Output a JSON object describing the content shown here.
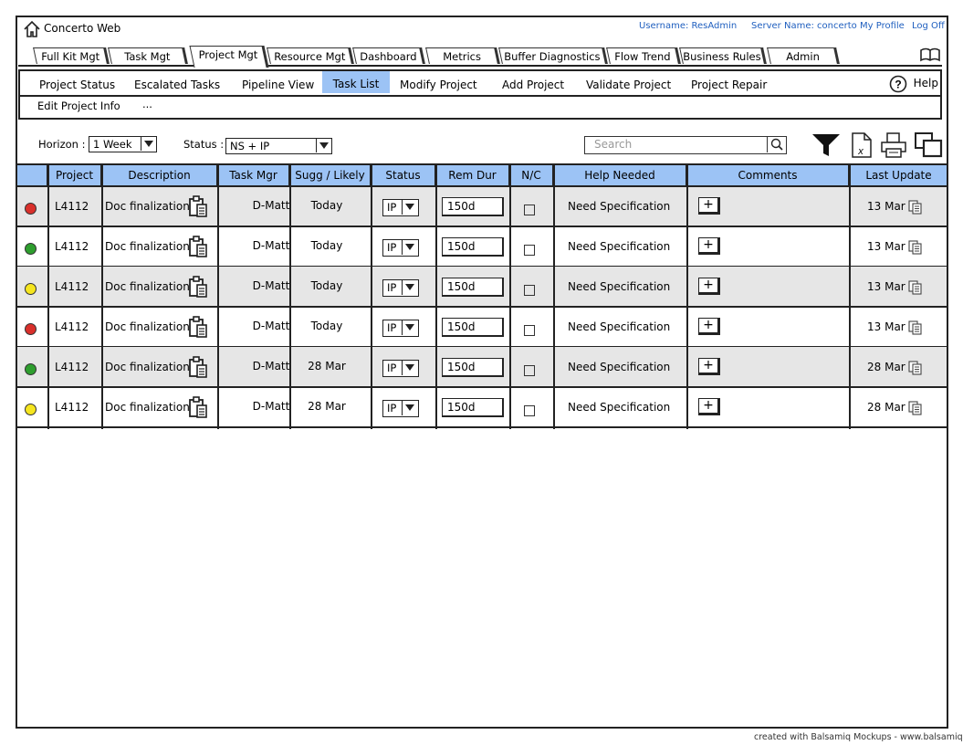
{
  "app": {
    "title": "Concerto Web"
  },
  "top_links": {
    "username": "Username: ResAdmin",
    "server": "Server Name: concerto",
    "my_profile": "My Profile",
    "log_off": "Log Off"
  },
  "tabs": [
    {
      "label": "Full Kit Mgt"
    },
    {
      "label": "Task Mgt"
    },
    {
      "label": "Project Mgt",
      "active": true
    },
    {
      "label": "Resource Mgt"
    },
    {
      "label": "Dashboard"
    },
    {
      "label": "Metrics"
    },
    {
      "label": "Buffer Diagnostics"
    },
    {
      "label": "Flow Trend"
    },
    {
      "label": "Business Rules"
    },
    {
      "label": "Admin"
    }
  ],
  "submenu": {
    "items": [
      {
        "label": "Project Status"
      },
      {
        "label": "Escalated Tasks"
      },
      {
        "label": "Pipeline View"
      },
      {
        "label": "Task List",
        "active": true
      },
      {
        "label": "Modify Project"
      },
      {
        "label": "Add Project"
      },
      {
        "label": "Validate Project"
      },
      {
        "label": "Project Repair"
      }
    ],
    "row2": [
      "Edit Project Info",
      "..."
    ],
    "help_label": "Help"
  },
  "filters": {
    "horizon_label": "Horizon :",
    "horizon_value": "1 Week",
    "status_label": "Status :",
    "status_value": "NS + IP",
    "search_placeholder": "Search"
  },
  "table": {
    "headers": [
      "Project",
      "Description",
      "Task Mgr",
      "Sugg / Likely",
      "Status",
      "Rem Dur",
      "N/C",
      "Help Needed",
      "Comments",
      "Last Update"
    ],
    "rows": [
      {
        "indicator": "red",
        "project": "L4112",
        "description": "Doc finalization",
        "task_mgr": "D-Matt",
        "sugg": "Today",
        "status": "IP",
        "rem_dur": "150d",
        "help": "Need Specification",
        "comment_btn": "+",
        "last_update": "13 Mar"
      },
      {
        "indicator": "green",
        "project": "L4112",
        "description": "Doc finalization",
        "task_mgr": "D-Matt",
        "sugg": "Today",
        "status": "IP",
        "rem_dur": "150d",
        "help": "Need Specification",
        "comment_btn": "+",
        "last_update": "13 Mar"
      },
      {
        "indicator": "yellow",
        "project": "L4112",
        "description": "Doc finalization",
        "task_mgr": "D-Matt",
        "sugg": "Today",
        "status": "IP",
        "rem_dur": "150d",
        "help": "Need Specification",
        "comment_btn": "+",
        "last_update": "13 Mar"
      },
      {
        "indicator": "red",
        "project": "L4112",
        "description": "Doc finalization",
        "task_mgr": "D-Matt",
        "sugg": "Today",
        "status": "IP",
        "rem_dur": "150d",
        "help": "Need Specification",
        "comment_btn": "+",
        "last_update": "13 Mar"
      },
      {
        "indicator": "green",
        "project": "L4112",
        "description": "Doc finalization",
        "task_mgr": "D-Matt",
        "sugg": "28 Mar",
        "status": "IP",
        "rem_dur": "150d",
        "help": "Need Specification",
        "comment_btn": "+",
        "last_update": "28 Mar"
      },
      {
        "indicator": "yellow",
        "project": "L4112",
        "description": "Doc finalization",
        "task_mgr": "D-Matt",
        "sugg": "28 Mar",
        "status": "IP",
        "rem_dur": "150d",
        "help": "Need Specification",
        "comment_btn": "+",
        "last_update": "28 Mar"
      }
    ]
  },
  "colors": {
    "header_blue": "#9cc3f5",
    "red": "#d9302b",
    "green": "#2e9e2e",
    "yellow": "#f5e51f",
    "row_shade": "#e6e6e6",
    "link_blue": "#1f5fbf"
  },
  "footer": "created with Balsamiq Mockups - www.balsamiq.com"
}
